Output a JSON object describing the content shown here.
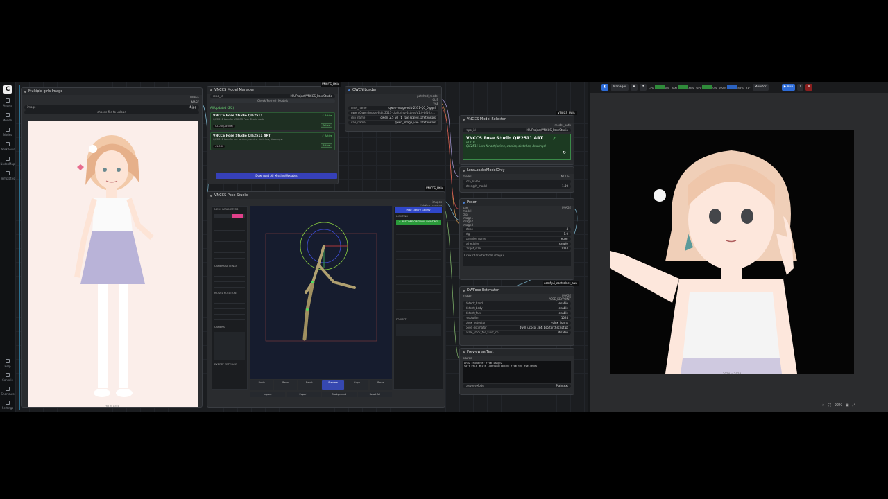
{
  "sidebar": {
    "logo": "C",
    "items": [
      {
        "label": "Assets"
      },
      {
        "label": "Models"
      },
      {
        "label": "Nodes"
      },
      {
        "label": "Workflows"
      },
      {
        "label": "NodesMap"
      },
      {
        "label": "Templates"
      },
      {
        "label": "Help"
      },
      {
        "label": "Console"
      },
      {
        "label": "Shortcuts"
      },
      {
        "label": "Settings"
      }
    ]
  },
  "nodes": {
    "multiple_girls": {
      "title": "Multiple girls Image",
      "output_image": "IMAGE",
      "output_mask": "MASK",
      "image_field": "image",
      "image_value": "4.jpg",
      "upload_label": "choose file to upload",
      "dims": "768 × 1344"
    },
    "model_manager": {
      "title": "VNCCS Model Manager",
      "repo_label": "repo_id",
      "repo_value": "MIUProject/VNCCS_PoseStudio",
      "check_button": "Check/Refresh Models",
      "status": "All Updated (2/2)",
      "cards": [
        {
          "name": "VNCCS Pose Studio QIE2511",
          "sub": "QIE2511 Lora for VNCCS Pose Studio node",
          "badge": "✓ Active",
          "version": "v2.0.0 (Active)",
          "action": "Active"
        },
        {
          "name": "VNCCS Pose Studio QIE2511 ART",
          "sub": "QIE2511 Lora for art (anime, comics, sketches, drawings)",
          "badge": "✓ Active",
          "version": "v1.0.0",
          "action": "Active"
        }
      ],
      "download_button": "Download All Missing/Updates"
    },
    "qwen_loader": {
      "title": "QWEN Loader",
      "outputs": [
        "patched_model",
        "CLIP",
        "VAE"
      ],
      "fields": [
        {
          "label": "unet_name",
          "value": "qwen-image-edit-2511-Q5_0.gguf"
        },
        {
          "label": "lora_name",
          "value": "qwen/Qwen-Image-Edit-2511-Lightning-4steps-V1.0-bf16.s..."
        },
        {
          "label": "clip_name",
          "value": "qwen_2.5_vl_7b_fp8_scaled.safetensors"
        },
        {
          "label": "vae_name",
          "value": "qwen_image_vae.safetensors"
        }
      ]
    },
    "vnccs_utils_tag": "VNCCS_Utils",
    "model_selector": {
      "title": "VNCCS Model Selector",
      "model_path": "model_path",
      "repo_label": "repo_id",
      "repo_value": "MIUProject/VNCCS_PoseStudio",
      "card_title": "VNCCS Pose Studio QIE2511 ART",
      "card_version": "v1.0.0",
      "card_desc": "QIE2511 Lora for art (anime, comics, sketches, drawings)"
    },
    "lora_loader": {
      "title": "LoraLoaderModelOnly",
      "input_model": "model",
      "output_model": "MODEL",
      "fields": [
        {
          "label": "lora_name",
          "value": ""
        },
        {
          "label": "strength_model",
          "value": "1.00"
        }
      ]
    },
    "poser": {
      "title": "Poser",
      "output": "IMAGE",
      "inputs": [
        "vae",
        "model",
        "clip",
        "image1",
        "image2",
        "image3"
      ],
      "fields": [
        {
          "label": "steps",
          "value": "4"
        },
        {
          "label": "cfg",
          "value": "1.0"
        },
        {
          "label": "sampler_name",
          "value": "euler"
        },
        {
          "label": "scheduler",
          "value": "simple"
        },
        {
          "label": "target_size",
          "value": "1024"
        }
      ],
      "prompt": "Draw character from image2"
    },
    "controlnet_tag": "comfyui_controlnet_aux",
    "dwpose": {
      "title": "DWPose Estimator",
      "input": "image",
      "outputs": [
        "IMAGE",
        "POSE_KEYPOINT"
      ],
      "fields": [
        {
          "label": "detect_hand",
          "value": "enable"
        },
        {
          "label": "detect_body",
          "value": "enable"
        },
        {
          "label": "detect_face",
          "value": "enable"
        },
        {
          "label": "resolution",
          "value": "1024"
        },
        {
          "label": "bbox_detector",
          "value": "yolox_l.onnx"
        },
        {
          "label": "pose_estimator",
          "value": "dw-ll_ucoco_384_bs5.torchscript.pt"
        },
        {
          "label": "scale_stick_for_xinsr_cn",
          "value": "disable"
        }
      ]
    },
    "preview_text": {
      "title": "Preview as Text",
      "input": "source",
      "text_line1": "Draw character from image2",
      "text_line2": "soft Pale White lighting coming from the eye-level.",
      "mode_label": "previewMode",
      "mode_value": "Plaintext"
    },
    "pose_studio": {
      "title": "VNCCS Pose Studio",
      "outputs": [
        "images",
        "lighting_prompt"
      ],
      "left_sections": [
        "MESH PARAMETERS",
        "CAMERA SETTINGS",
        "MODEL ROTATION",
        "CAMERA",
        "EXPORT SETTINGS"
      ],
      "right_button": "Pose Library Gallery",
      "lighting_label": "LIGHTING",
      "lighting_button": "+ RESTORE ORIGINAL LIGHTING",
      "prompt_label": "PROMPT",
      "bottom_buttons": [
        "Undo",
        "Redo",
        "Reset",
        "Preview",
        "Copy",
        "Paste"
      ],
      "footer_buttons": [
        "Import",
        "Export",
        "Background",
        "Reset All"
      ]
    }
  },
  "toolbar": {
    "manager": "Manager",
    "cpu_label": "CPU",
    "cpu_value": "0%",
    "ram_label": "RAM",
    "ram_value": "36%",
    "gpu_label": "GPU",
    "gpu_value": "0%",
    "vram_label": "VRAM",
    "vram_value": "86%",
    "temp_value": "31°",
    "monitor": "Monitor",
    "run": "Run",
    "run_count": "1"
  },
  "bottom_tools": {
    "zoom": "92%"
  },
  "colors": {
    "accent_blue": "#2d6bd6",
    "active_green": "#6ee07a",
    "canvas_bg": "#1b1d20"
  }
}
